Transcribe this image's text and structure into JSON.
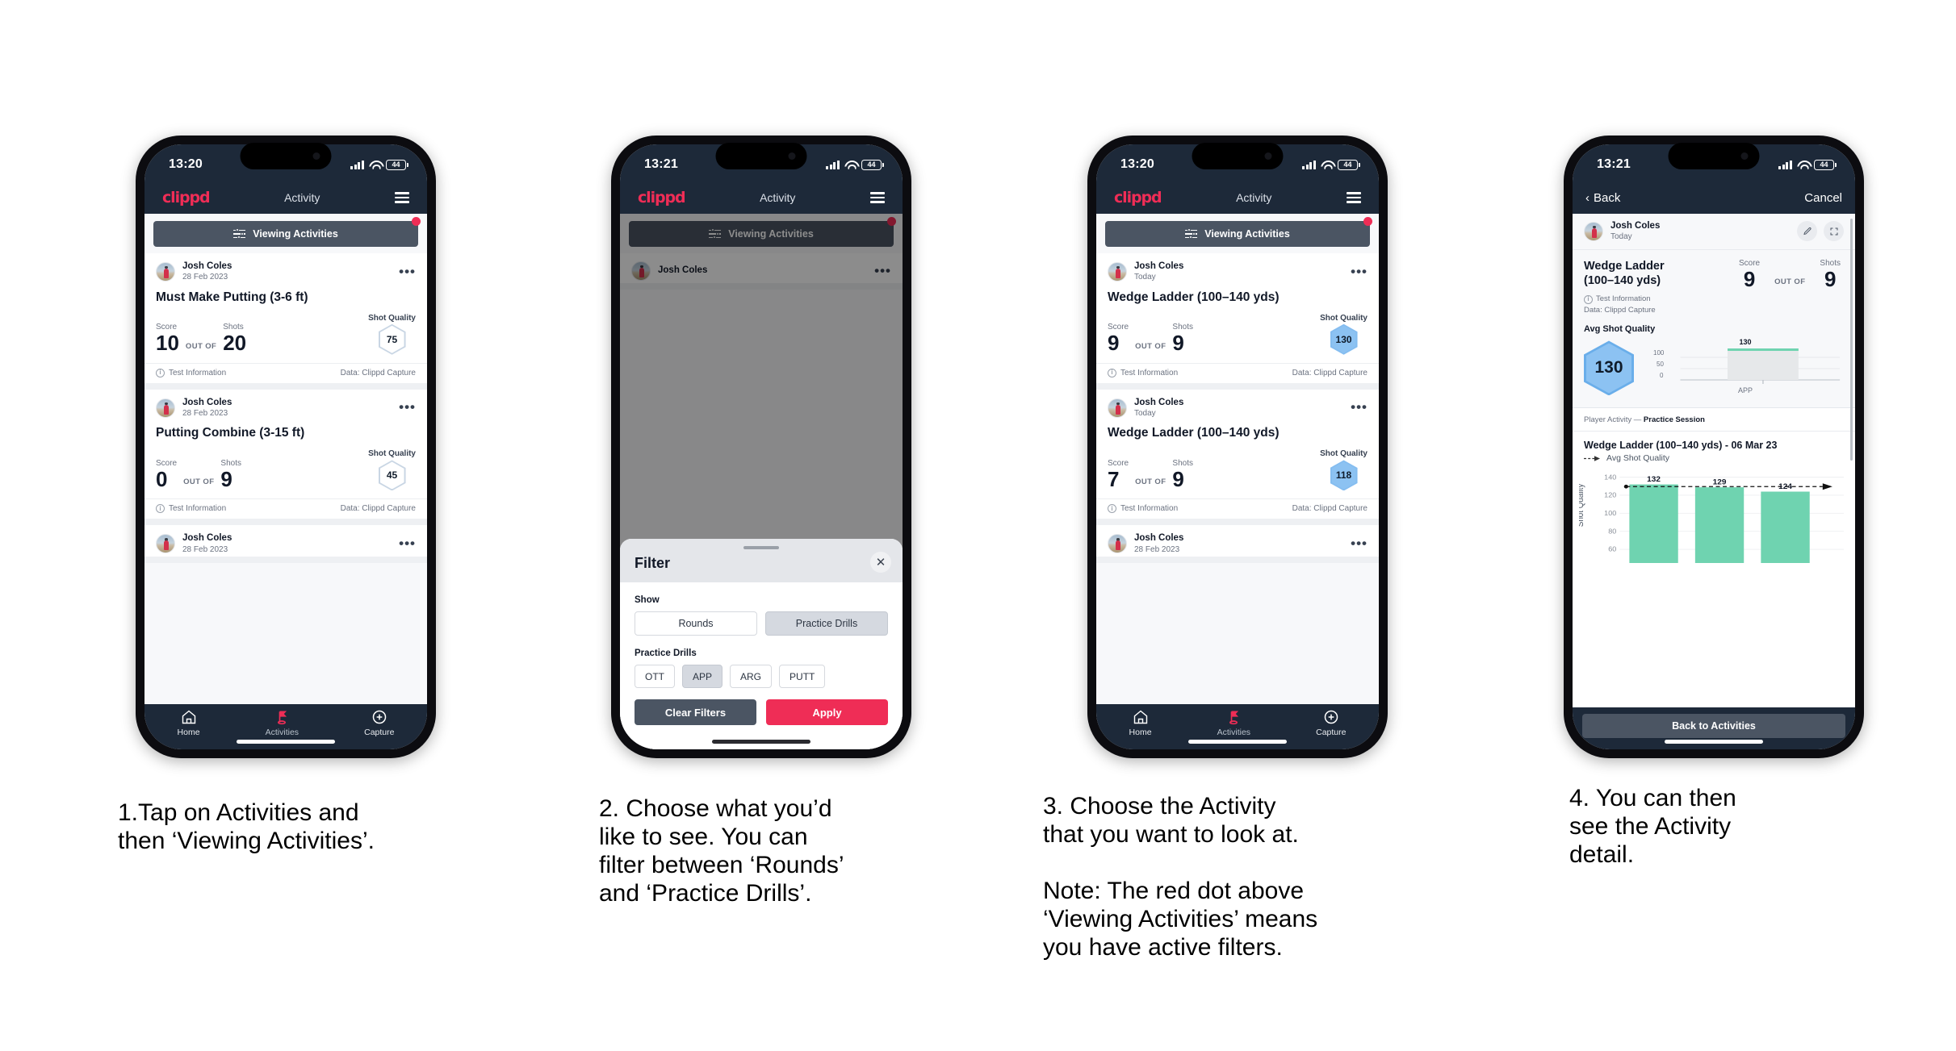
{
  "phones": [
    {
      "id": "phone-activities-list",
      "status": {
        "time": "13:20",
        "battery": "44"
      },
      "appbar": {
        "brand": "clippd",
        "title": "Activity",
        "menu_icon": "hamburger-icon"
      },
      "filter_button": {
        "label": "Viewing Activities",
        "icon": "sliders-icon",
        "has_badge": true
      },
      "cards": [
        {
          "user": "Josh Coles",
          "date": "28 Feb 2023",
          "title": "Must Make Putting (3-6 ft)",
          "score_label": "Score",
          "score": "10",
          "out_of": "OUT OF",
          "shots_label": "Shots",
          "shots": "20",
          "quality_label": "Shot Quality",
          "quality": "75",
          "quality_style": "outline",
          "foot_left": "Test Information",
          "foot_right": "Data: Clippd Capture"
        },
        {
          "user": "Josh Coles",
          "date": "28 Feb 2023",
          "title": "Putting Combine (3-15 ft)",
          "score_label": "Score",
          "score": "0",
          "out_of": "OUT OF",
          "shots_label": "Shots",
          "shots": "9",
          "quality_label": "Shot Quality",
          "quality": "45",
          "quality_style": "outline",
          "foot_left": "Test Information",
          "foot_right": "Data: Clippd Capture"
        }
      ],
      "partial_card": {
        "user": "Josh Coles",
        "date": "28 Feb 2023"
      },
      "tabs": [
        {
          "label": "Home",
          "icon": "home-icon",
          "active": false
        },
        {
          "label": "Activities",
          "icon": "golf-flag-icon",
          "active": true
        },
        {
          "label": "Capture",
          "icon": "plus-circle-icon",
          "active": false
        }
      ]
    },
    {
      "id": "phone-filter-sheet",
      "status": {
        "time": "13:21",
        "battery": "44"
      },
      "appbar": {
        "brand": "clippd",
        "title": "Activity",
        "menu_icon": "hamburger-icon"
      },
      "filter_button": {
        "label": "Viewing Activities",
        "icon": "sliders-icon",
        "has_badge": true
      },
      "dim_card": {
        "user": "Josh Coles"
      },
      "sheet": {
        "title": "Filter",
        "close_icon": "close-icon",
        "show_label": "Show",
        "show_options": [
          {
            "label": "Rounds",
            "selected": false
          },
          {
            "label": "Practice Drills",
            "selected": true
          }
        ],
        "drills_label": "Practice Drills",
        "drill_options": [
          {
            "label": "OTT",
            "selected": false
          },
          {
            "label": "APP",
            "selected": true
          },
          {
            "label": "ARG",
            "selected": false
          },
          {
            "label": "PUTT",
            "selected": false
          }
        ],
        "clear_label": "Clear Filters",
        "apply_label": "Apply"
      }
    },
    {
      "id": "phone-wedge-ladder-list",
      "status": {
        "time": "13:20",
        "battery": "44"
      },
      "appbar": {
        "brand": "clippd",
        "title": "Activity",
        "menu_icon": "hamburger-icon"
      },
      "filter_button": {
        "label": "Viewing Activities",
        "icon": "sliders-icon",
        "has_badge": true
      },
      "cards": [
        {
          "user": "Josh Coles",
          "date": "Today",
          "title": "Wedge Ladder (100–140 yds)",
          "score_label": "Score",
          "score": "9",
          "out_of": "OUT OF",
          "shots_label": "Shots",
          "shots": "9",
          "quality_label": "Shot Quality",
          "quality": "130",
          "quality_style": "filled",
          "foot_left": "Test Information",
          "foot_right": "Data: Clippd Capture"
        },
        {
          "user": "Josh Coles",
          "date": "Today",
          "title": "Wedge Ladder (100–140 yds)",
          "score_label": "Score",
          "score": "7",
          "out_of": "OUT OF",
          "shots_label": "Shots",
          "shots": "9",
          "quality_label": "Shot Quality",
          "quality": "118",
          "quality_style": "filled",
          "foot_left": "Test Information",
          "foot_right": "Data: Clippd Capture"
        }
      ],
      "partial_card": {
        "user": "Josh Coles",
        "date": "28 Feb 2023"
      },
      "tabs": [
        {
          "label": "Home",
          "icon": "home-icon",
          "active": false
        },
        {
          "label": "Activities",
          "icon": "golf-flag-icon",
          "active": true
        },
        {
          "label": "Capture",
          "icon": "plus-circle-icon",
          "active": false
        }
      ]
    },
    {
      "id": "phone-activity-detail",
      "status": {
        "time": "13:21",
        "battery": "44"
      },
      "navbar": {
        "back_label": "Back",
        "back_icon": "chevron-left-icon",
        "cancel_label": "Cancel"
      },
      "detail": {
        "user": "Josh Coles",
        "date": "Today",
        "edit_icon": "pencil-icon",
        "expand_icon": "expand-icon",
        "title": "Wedge Ladder\n(100–140 yds)",
        "info_label": "Test Information",
        "data_label": "Data: Clippd Capture",
        "score_label": "Score",
        "score": "9",
        "out_of": "OUT OF",
        "shots_label": "Shots",
        "shots": "9",
        "avg_label": "Avg Shot Quality",
        "avg_value": "130",
        "breadcrumb_prefix": "Player Activity — ",
        "breadcrumb_current": "Practice Session",
        "chart_title": "Wedge Ladder (100–140 yds) - 06 Mar 23",
        "legend_label": "Avg Shot Quality",
        "back_to_activities": "Back to Activities"
      },
      "chart_data": [
        {
          "type": "bar",
          "name": "avg-shot-quality-mini",
          "categories": [
            "APP"
          ],
          "values": [
            130
          ],
          "data_labels": [
            "130"
          ],
          "ylim": [
            0,
            140
          ],
          "yticks": [
            0,
            50,
            100
          ],
          "ytick_labels": [
            "0",
            "50",
            "100"
          ],
          "title": "",
          "xlabel": "",
          "ylabel": "",
          "grid": true,
          "bar_color": "#e6e8ea",
          "cap_color": "#6fd3b0"
        },
        {
          "type": "bar",
          "name": "shot-quality-by-shot",
          "categories": [
            "1",
            "2",
            "3"
          ],
          "values": [
            132,
            129,
            124
          ],
          "data_labels": [
            "132",
            "129",
            "124"
          ],
          "ylim": [
            55,
            145
          ],
          "yticks": [
            60,
            80,
            100,
            120,
            140
          ],
          "ytick_labels": [
            "140",
            "120",
            "100",
            "80",
            "60"
          ],
          "title": "Wedge Ladder (100–140 yds) - 06 Mar 23",
          "xlabel": "",
          "ylabel": "Shot Quality",
          "legend": [
            "Avg Shot Quality"
          ],
          "avg_line": 130,
          "grid": true,
          "bar_color": "#6fd3b0"
        }
      ]
    }
  ],
  "captions": [
    {
      "text": "1.Tap on Activities and\nthen ‘Viewing Activities’."
    },
    {
      "text": "2. Choose what you’d\nlike to see. You can\nfilter between ‘Rounds’\nand ‘Practice Drills’."
    },
    {
      "text": "3. Choose the Activity\nthat you want to look at.\n\nNote: The red dot above\n‘Viewing Activities’ means\nyou have active filters."
    },
    {
      "text": "4. You can then\nsee the Activity\ndetail."
    }
  ]
}
